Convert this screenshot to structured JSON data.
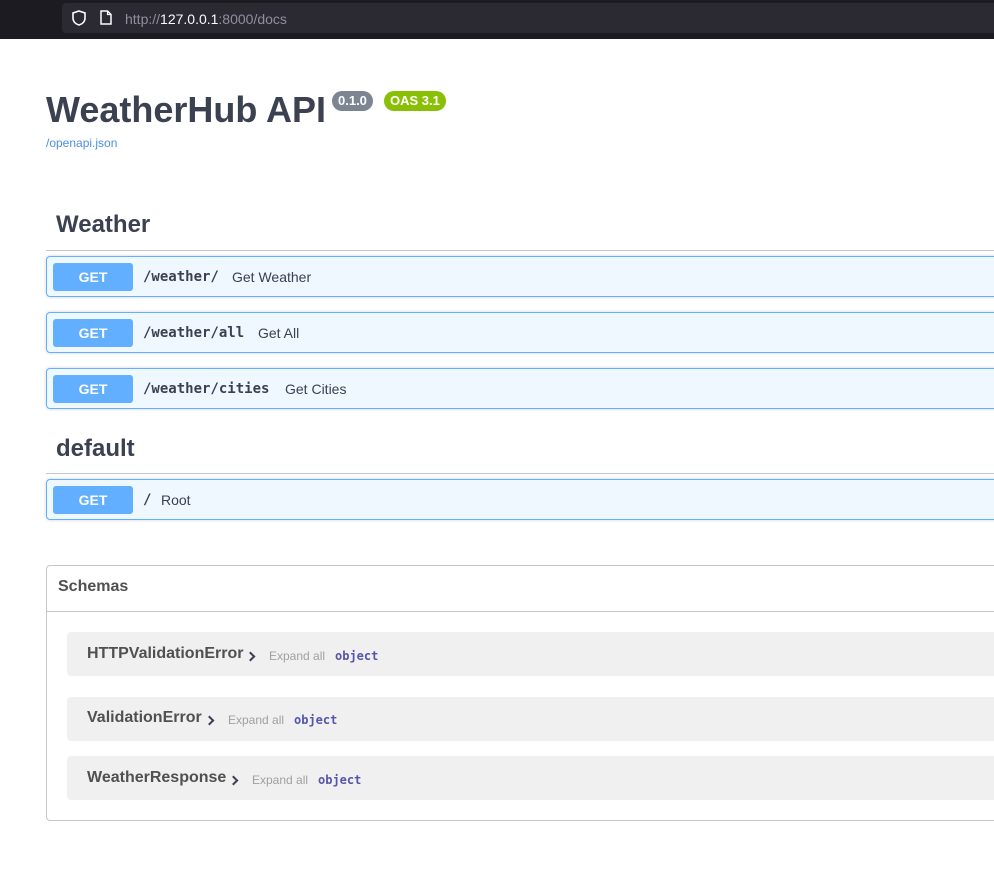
{
  "browser": {
    "url_prefix": "http://",
    "url_host": "127.0.0.1",
    "url_rest": ":8000/docs"
  },
  "info": {
    "title": "WeatherHub API",
    "version_badge": "0.1.0",
    "oas_badge": "OAS 3.1",
    "spec_link": "/openapi.json"
  },
  "tags": {
    "weather": {
      "name": "Weather",
      "operations": [
        {
          "method": "GET",
          "path": "/weather/",
          "summary": "Get Weather"
        },
        {
          "method": "GET",
          "path": "/weather/all",
          "summary": "Get All"
        },
        {
          "method": "GET",
          "path": "/weather/cities",
          "summary": "Get Cities"
        }
      ]
    },
    "default": {
      "name": "default",
      "operations": [
        {
          "method": "GET",
          "path": "/",
          "summary": "Root"
        }
      ]
    }
  },
  "schemas": {
    "title": "Schemas",
    "items": [
      {
        "name": "HTTPValidationError",
        "expand": "Expand all",
        "type": "object"
      },
      {
        "name": "ValidationError",
        "expand": "Expand all",
        "type": "object"
      },
      {
        "name": "WeatherResponse",
        "expand": "Expand all",
        "type": "object"
      }
    ]
  },
  "colors": {
    "get_method": "#61affe",
    "oas_badge": "#89bf04",
    "version_badge": "#7d8492",
    "link": "#4990e2"
  }
}
